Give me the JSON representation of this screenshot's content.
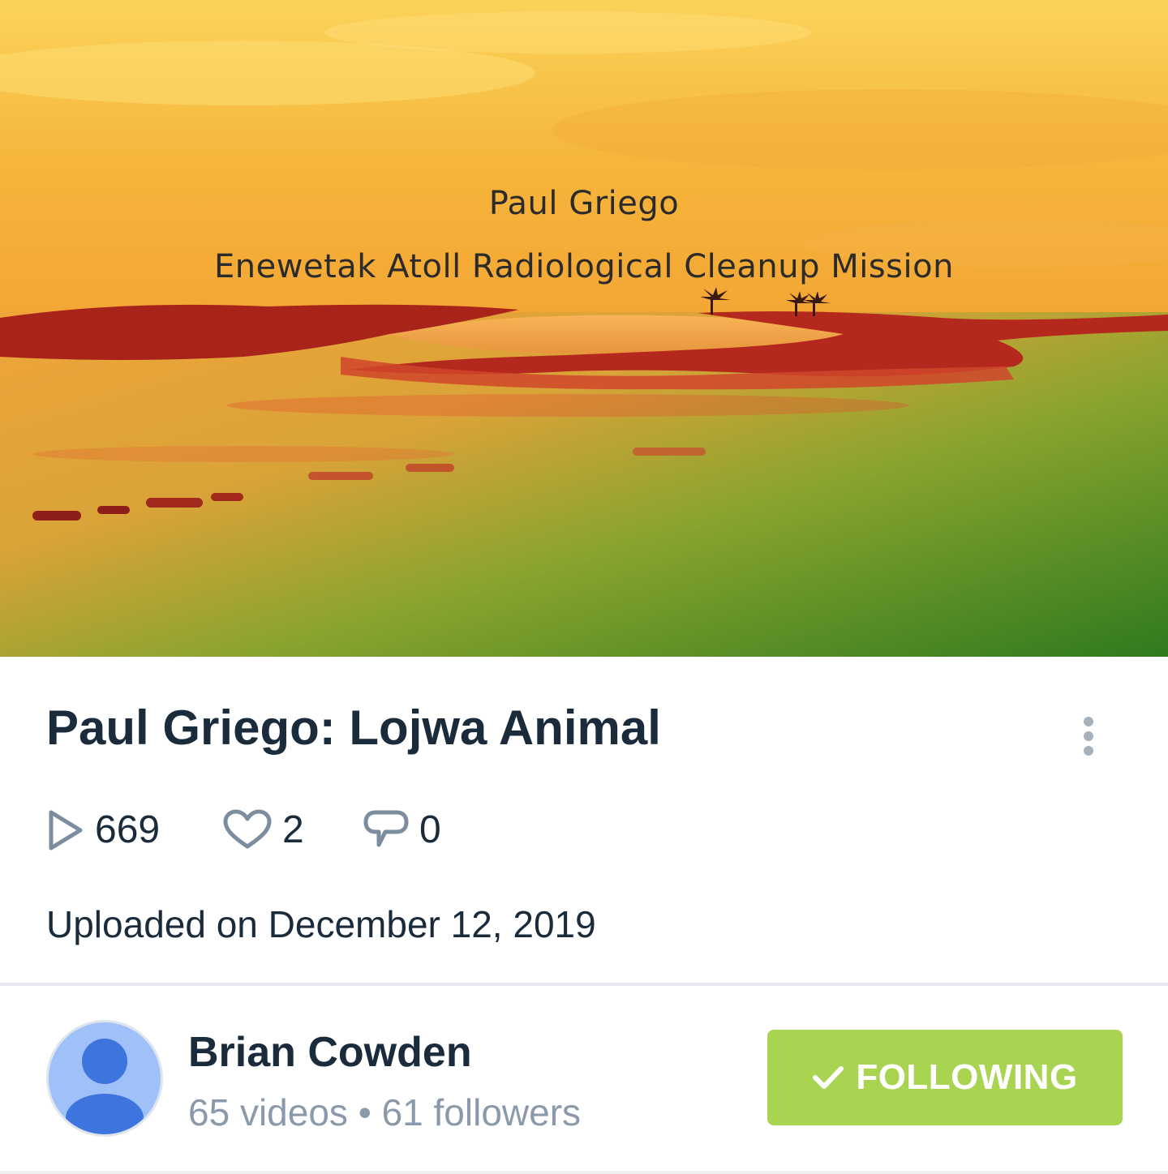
{
  "video": {
    "thumbnail": {
      "line1": "Paul Griego",
      "line2": "Enewetak Atoll Radiological Cleanup Mission"
    },
    "title": "Paul Griego: Lojwa Animal",
    "stats": {
      "plays": "669",
      "likes": "2",
      "comments": "0"
    },
    "uploaded": "Uploaded on December 12, 2019"
  },
  "channel": {
    "name": "Brian Cowden",
    "meta": "65 videos • 61 followers",
    "follow_label": "FOLLOWING"
  },
  "colors": {
    "text_primary": "#1a2b3c",
    "text_secondary": "#8a9aab",
    "follow_button": "#a9d452",
    "icon_gray": "#7b8d9e",
    "avatar_bg": "#9fc0f8",
    "avatar_fg": "#3e74dd"
  },
  "icons": {
    "plays": "play-outline-icon",
    "likes": "heart-outline-icon",
    "comments": "speech-bubble-icon",
    "more": "vertical-dots-icon",
    "follow": "checkmark-icon"
  }
}
